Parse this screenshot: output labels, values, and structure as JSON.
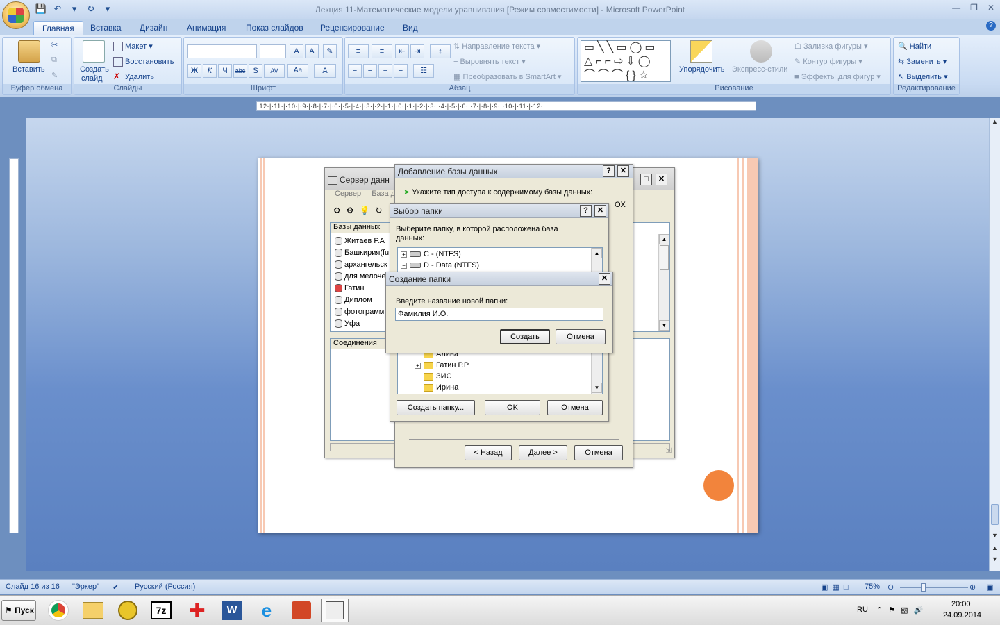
{
  "window": {
    "title": "Лекция 11-Математические модели уравнивания [Режим совместимости] - Microsoft PowerPoint"
  },
  "ribbon_tabs": [
    "Главная",
    "Вставка",
    "Дизайн",
    "Анимация",
    "Показ слайдов",
    "Рецензирование",
    "Вид"
  ],
  "ribbon": {
    "clipboard": {
      "label": "Буфер обмена",
      "paste": "Вставить"
    },
    "slides": {
      "label": "Слайды",
      "new_slide_1": "Создать",
      "new_slide_2": "слайд",
      "layout": "Макет",
      "reset": "Восстановить",
      "delete": "Удалить"
    },
    "font": {
      "label": "Шрифт"
    },
    "paragraph": {
      "label": "Абзац",
      "text_direction": "Направление текста",
      "align_text": "Выровнять текст",
      "smartart": "Преобразовать в SmartArt"
    },
    "drawing": {
      "label": "Рисование",
      "arrange": "Упорядочить",
      "quick_styles": "Экспресс-стили",
      "fill": "Заливка фигуры",
      "outline": "Контур фигуры",
      "effects": "Эффекты для фигур"
    },
    "editing": {
      "label": "Редактирование",
      "find": "Найти",
      "replace": "Заменить",
      "select": "Выделить"
    }
  },
  "ruler_text": "·12·|·11·|·10·|·9·|·8·|·7·|·6·|·5·|·4·|·3·|·2·|·1·|·0·|·1·|·2·|·3·|·4·|·5·|·6·|·7·|·8·|·9·|·10·|·11·|·12·",
  "server_window": {
    "title": "Сервер данн",
    "menu": [
      "Сервер",
      "База д"
    ],
    "databases_header": "Базы данных",
    "databases": [
      "Житаев Р.А",
      "Башкирия(fu",
      "архангельск",
      "для мелоче",
      "Гатин",
      "Диплом",
      "фотограмм",
      "Уфа"
    ],
    "connections_header": "Соединения"
  },
  "add_db_dialog": {
    "title": "Добавление базы данных",
    "prompt": "Укажите тип доступа к содержимому базы данных:",
    "back": "< Назад",
    "next": "Далее >",
    "cancel": "Отмена"
  },
  "folder_dialog": {
    "title": "Выбор папки",
    "prompt": "Выберите папку, в которой расположена база данных:",
    "drives": [
      "C - (NTFS)",
      "D - Data (NTFS)"
    ],
    "folders": [
      "Алина",
      "Гатин Р.Р",
      "ЗИС",
      "Ирина"
    ],
    "create_folder": "Создать папку...",
    "ok": "OK",
    "cancel": "Отмена"
  },
  "new_folder_dialog": {
    "title": "Создание папки",
    "label": "Введите название новой папки:",
    "value": "Фамилия И.О.",
    "create": "Создать",
    "cancel": "Отмена"
  },
  "statusbar": {
    "slide": "Слайд 16 из 16",
    "theme": "\"Эркер\"",
    "language": "Русский (Россия)",
    "zoom": "75%"
  },
  "taskbar": {
    "start": "Пуск",
    "lang": "RU",
    "time": "20:00",
    "date": "24.09.2014"
  },
  "colors": {
    "accent": "#15428b",
    "slide_stripe": "#f7c9b3",
    "orange": "#f2843c"
  }
}
